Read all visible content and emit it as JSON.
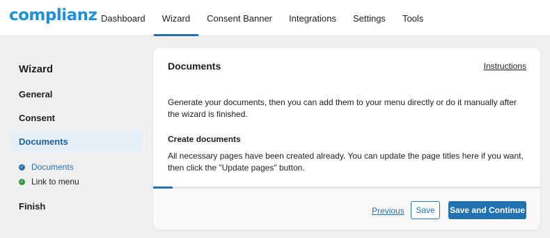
{
  "header": {
    "logo": "complianz",
    "nav": [
      {
        "label": "Dashboard"
      },
      {
        "label": "Wizard"
      },
      {
        "label": "Consent Banner"
      },
      {
        "label": "Integrations"
      },
      {
        "label": "Settings"
      },
      {
        "label": "Tools"
      }
    ],
    "active_nav": "Wizard"
  },
  "sidebar": {
    "title": "Wizard",
    "steps": [
      {
        "label": "General"
      },
      {
        "label": "Consent"
      },
      {
        "label": "Documents"
      },
      {
        "label": "Finish"
      }
    ],
    "active_step": "Documents",
    "substeps": [
      {
        "label": "Documents",
        "status": "current"
      },
      {
        "label": "Link to menu",
        "status": "done"
      }
    ]
  },
  "card": {
    "title": "Documents",
    "instructions_link": "Instructions",
    "intro": "Generate your documents, then you can add them to your menu directly or do it manually after the wizard is finished.",
    "section_title": "Create documents",
    "section_text": "All necessary pages have been created already. You can update the page titles here if you want, then click the \"Update pages\" button.",
    "progress_fraction": 0.05
  },
  "footer": {
    "previous_label": "Previous",
    "save_label": "Save",
    "continue_label": "Save and Continue"
  },
  "colors": {
    "brand": "#1d8fdb",
    "accent": "#2271b1",
    "success": "#2b9a3b",
    "active_step_bg": "#e6f0f8"
  }
}
